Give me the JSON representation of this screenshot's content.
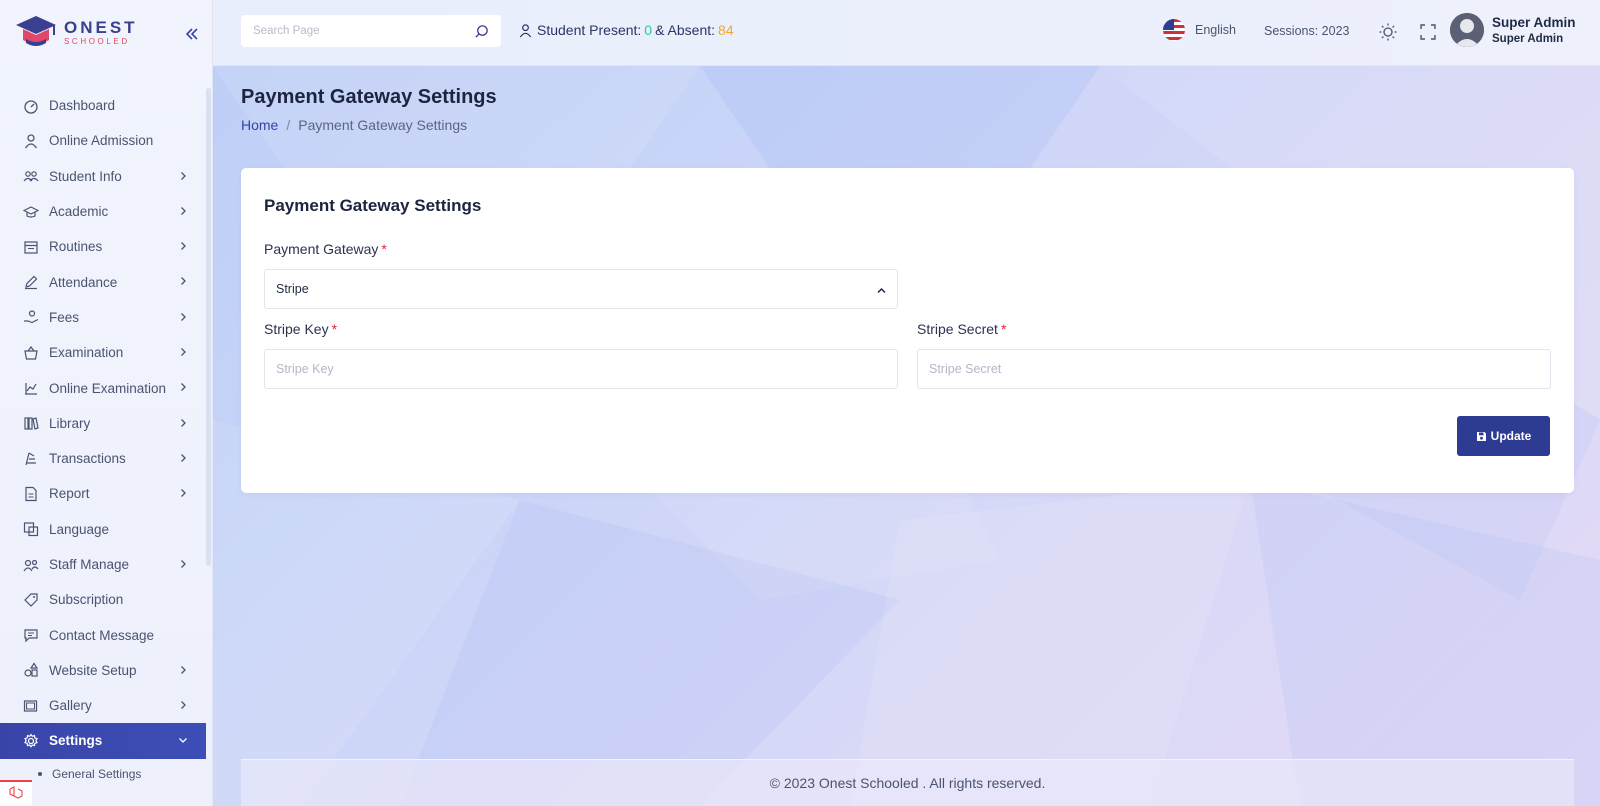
{
  "brand": {
    "name": "ONEST",
    "sub": "SCHOOLED"
  },
  "sidebar": {
    "items": [
      {
        "label": "Dashboard",
        "icon": "dashboard-icon",
        "chevron": false
      },
      {
        "label": "Online Admission",
        "icon": "user-icon",
        "chevron": false
      },
      {
        "label": "Student Info",
        "icon": "users-icon",
        "chevron": true
      },
      {
        "label": "Academic",
        "icon": "graduation-cap-icon",
        "chevron": true
      },
      {
        "label": "Routines",
        "icon": "calendar-icon",
        "chevron": true
      },
      {
        "label": "Attendance",
        "icon": "pen-icon",
        "chevron": true
      },
      {
        "label": "Fees",
        "icon": "money-hand-icon",
        "chevron": true
      },
      {
        "label": "Examination",
        "icon": "basket-icon",
        "chevron": true
      },
      {
        "label": "Online Examination",
        "icon": "chart-icon",
        "chevron": true
      },
      {
        "label": "Library",
        "icon": "books-icon",
        "chevron": true
      },
      {
        "label": "Transactions",
        "icon": "transaction-icon",
        "chevron": true
      },
      {
        "label": "Report",
        "icon": "report-icon",
        "chevron": true
      },
      {
        "label": "Language",
        "icon": "language-icon",
        "chevron": false
      },
      {
        "label": "Staff Manage",
        "icon": "staff-icon",
        "chevron": true
      },
      {
        "label": "Subscription",
        "icon": "tag-icon",
        "chevron": false
      },
      {
        "label": "Contact Message",
        "icon": "message-icon",
        "chevron": false
      },
      {
        "label": "Website Setup",
        "icon": "shapes-icon",
        "chevron": true
      },
      {
        "label": "Gallery",
        "icon": "gallery-icon",
        "chevron": true
      },
      {
        "label": "Settings",
        "icon": "gear-icon",
        "chevron": true,
        "active": true
      }
    ],
    "submenu": [
      {
        "label": "General Settings"
      }
    ]
  },
  "header": {
    "search_placeholder": "Search Page",
    "present_label": "Student Present:",
    "present_value": "0",
    "absent_label": "& Absent:",
    "absent_value": "84",
    "language": "English",
    "sessions": "Sessions: 2023",
    "user_name": "Super Admin",
    "user_role": "Super Admin"
  },
  "page": {
    "title": "Payment Gateway Settings",
    "breadcrumb_home": "Home",
    "breadcrumb_sep": "/",
    "breadcrumb_current": "Payment Gateway Settings"
  },
  "form": {
    "card_title": "Payment Gateway Settings",
    "gateway_label": "Payment Gateway",
    "gateway_value": "Stripe",
    "key_label": "Stripe Key",
    "key_placeholder": "Stripe Key",
    "secret_label": "Stripe Secret",
    "secret_placeholder": "Stripe Secret",
    "required_mark": "*",
    "update_label": "Update"
  },
  "footer": {
    "text": "© 2023 Onest Schooled . All rights reserved."
  },
  "colors": {
    "primary": "#2e3b93",
    "present": "#2fc89a",
    "absent": "#f3a43a",
    "required": "#e0243e"
  }
}
